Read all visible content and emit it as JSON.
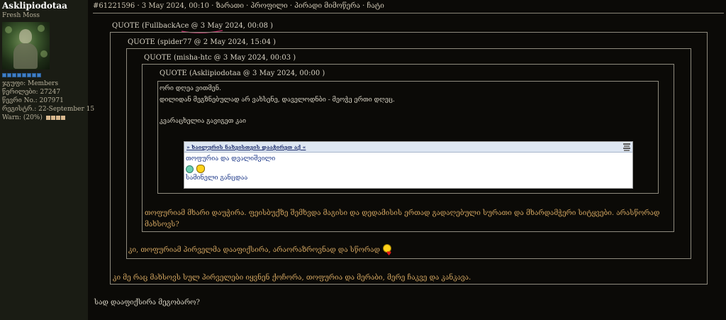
{
  "sidebar": {
    "username": "Asklipiodotaa",
    "rank": "Fresh Moss",
    "group": "ჯგუფი: Members",
    "posts": "წერილები: 27247",
    "member_no": "წევრი No.: 207971",
    "registered": "რეგისტრ.: 22-September 15",
    "warn": "Warn: (20%)"
  },
  "post": {
    "header": "#61221596 · 3 May 2024, 00:10 · ზარათი · პროფილი · პირადი მიმოწერა · ჩატი"
  },
  "quotes": {
    "q1_label": "QUOTE",
    "q1_meta": "(FullbackAce @ 3 May 2024, 00:08 )",
    "q2_label": "QUOTE",
    "q2_meta": "(spider77 @ 2 May 2024, 15:04 )",
    "q3_label": "QUOTE",
    "q3_meta": "(misha-htc @ 3 May 2024, 00:03 )",
    "q4_label": "QUOTE",
    "q4_meta": "(Asklipiodotaa @ 3 May 2024, 00:00 )",
    "q4_line1": "ორი დღეა ვითმენ.",
    "q4_line2": "დილიდან მეგზნებულად არ ვახსენე, დაველოდნბი - მეოჭე ერთი დღეც.",
    "q4_line3": "კვარაცხელია გავიგეთ კაი",
    "q3_text_line1": "თოფურიამ მხარი დაუჭირა. ფეისბუქზე შემხვდა მაგისი და დედამისის ერთად გადაღებული სურათი და მხარდამჭერი სიტყვები. არასწორად",
    "q3_text_line2": "მახსოვს?",
    "q2_text": "კი, თოფურიამ პირველმა დააფიქსირა, არაორაზროვნად და სწორად",
    "q1_text": "კი მე რაც მახსოვს სულ პირველები იყვნენ ქოჩორა, თოფურია და მერაბი, მერე ჩაკვე და კანკავა."
  },
  "embed": {
    "header_link": "» ხაილურის ნახვისთვის დააჭირეთ აქ «",
    "line1": "თოფურია და დვალიშვილი",
    "line2": "სამინელი განცდაა"
  },
  "reply": "სად დააფიქსირა მეგობარო?",
  "colors": {
    "background": "#0b0a07",
    "sidebar": "#1a1c14",
    "quote_text": "#d2a560",
    "border": "#8f8b7e"
  }
}
